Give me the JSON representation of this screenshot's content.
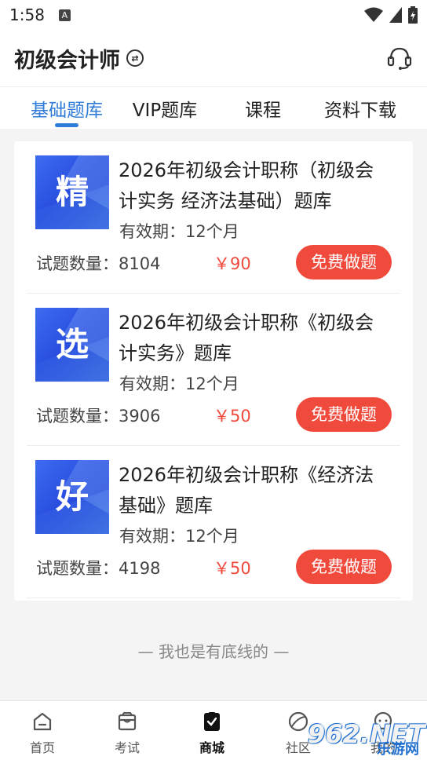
{
  "status_bar": {
    "time": "1:58",
    "badge": "A"
  },
  "app_bar": {
    "title": "初级会计师",
    "switch_icon": "⇄"
  },
  "tabs": [
    {
      "label": "基础题库",
      "active": true
    },
    {
      "label": "VIP题库",
      "active": false
    },
    {
      "label": "课程",
      "active": false
    },
    {
      "label": "资料下载",
      "active": false
    }
  ],
  "items": [
    {
      "thumb_char": "精",
      "name": "2026年初级会计职称（初级会计实务 经济法基础）题库",
      "valid": "有效期：12个月",
      "count": "试题数量：8104",
      "price": "￥90",
      "button": "免费做题"
    },
    {
      "thumb_char": "选",
      "name": "2026年初级会计职称《初级会计实务》题库",
      "valid": "有效期：12个月",
      "count": "试题数量：3906",
      "price": "￥50",
      "button": "免费做题"
    },
    {
      "thumb_char": "好",
      "name": "2026年初级会计职称《经济法基础》题库",
      "valid": "有效期：12个月",
      "count": "试题数量：4198",
      "price": "￥50",
      "button": "免费做题"
    }
  ],
  "bottom_line": "— 我也是有底线的 —",
  "nav": [
    {
      "label": "首页",
      "icon": "home-icon",
      "active": false
    },
    {
      "label": "考试",
      "icon": "exam-icon",
      "active": false
    },
    {
      "label": "商城",
      "icon": "mall-icon",
      "active": true
    },
    {
      "label": "社区",
      "icon": "community-icon",
      "active": false
    },
    {
      "label": "我的",
      "icon": "chat-icon",
      "active": false
    }
  ],
  "watermark": {
    "num": "962.NET",
    "sub": "乐游网"
  },
  "colors": {
    "accent": "#2f7bd8",
    "price": "#f04a3c",
    "button": "#f04a3c"
  }
}
